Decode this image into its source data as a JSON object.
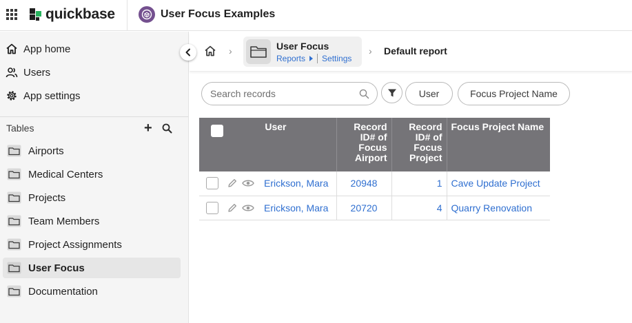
{
  "header": {
    "brand": "quickbase",
    "app_title": "User Focus Examples",
    "colors": {
      "brand_dark": "#1e1e1e",
      "brand_green": "#29b35e",
      "app_badge": "#74508f"
    }
  },
  "sidebar": {
    "links": [
      {
        "label": "App home",
        "icon": "home-icon"
      },
      {
        "label": "Users",
        "icon": "users-icon"
      },
      {
        "label": "App settings",
        "icon": "gear-icon"
      }
    ],
    "tables_heading": "Tables",
    "tables": [
      {
        "label": "Airports",
        "active": false
      },
      {
        "label": "Medical Centers",
        "active": false
      },
      {
        "label": "Projects",
        "active": false
      },
      {
        "label": "Team Members",
        "active": false
      },
      {
        "label": "Project Assignments",
        "active": false
      },
      {
        "label": "User Focus",
        "active": true
      },
      {
        "label": "Documentation",
        "active": false
      }
    ]
  },
  "breadcrumb": {
    "table_name": "User Focus",
    "reports_link": "Reports",
    "settings_link": "Settings",
    "current": "Default report"
  },
  "toolbar": {
    "search_placeholder": "Search records",
    "pills": [
      "User",
      "Focus Project Name"
    ]
  },
  "report": {
    "columns": [
      "User",
      "Record ID# of Focus Airport",
      "Record ID# of Focus Project",
      "Focus Project Name"
    ],
    "rows": [
      {
        "user": "Erickson, Mara",
        "airport_id": "20948",
        "project_id": "1",
        "project_name": "Cave Update Project"
      },
      {
        "user": "Erickson, Mara",
        "airport_id": "20720",
        "project_id": "4",
        "project_name": "Quarry Renovation"
      }
    ],
    "colors": {
      "header_bg": "#757478",
      "link": "#2f6fd0"
    }
  }
}
